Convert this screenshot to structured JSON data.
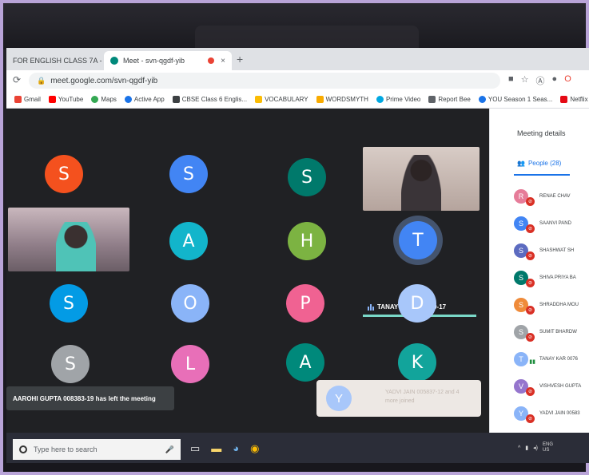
{
  "browser": {
    "tabs": [
      {
        "label": "FOR ENGLISH CLASS 7A - \\",
        "close": "×"
      },
      {
        "label": "Meet - svn-qgdf-yib",
        "close": "×"
      }
    ],
    "new_tab": "+",
    "url": "meet.google.com/svn-qgdf-yib",
    "bookmarks": [
      "Gmail",
      "YouTube",
      "Maps",
      "Active App",
      "CBSE Class 6 Englis...",
      "VOCABULARY",
      "WORDSMYTH",
      "Prime Video",
      "Report Bee",
      "YOU Season 1 Seas...",
      "Netflix"
    ]
  },
  "meet": {
    "tiles": [
      {
        "letter": "S",
        "color": "#f4511e"
      },
      {
        "letter": "S",
        "color": "#4285f4"
      },
      {
        "letter": "S",
        "color": "#00796b"
      },
      {
        "letter": "A",
        "color": "#12b5cb"
      },
      {
        "letter": "H",
        "color": "#7cb342"
      },
      {
        "letter": "T",
        "color": "#4285f4"
      },
      {
        "letter": "S",
        "color": "#039be5"
      },
      {
        "letter": "O",
        "color": "#8ab4f8"
      },
      {
        "letter": "P",
        "color": "#f06292"
      },
      {
        "letter": "D",
        "color": "#a8c7fa"
      },
      {
        "letter": "S",
        "color": "#a0a4a8"
      },
      {
        "letter": "L",
        "color": "#e86fb8"
      },
      {
        "letter": "A",
        "color": "#00897b"
      },
      {
        "letter": "K",
        "color": "#12a49b"
      }
    ],
    "active_speaker": "TANAY KAR 007689-17",
    "left_toast": "AAROHI GUPTA 008383-19 has left the meeting",
    "right_toast": {
      "avatar": "Y",
      "text": "YADVI JAIN 005837-12 and 4 more joined"
    }
  },
  "panel": {
    "title": "Meeting details",
    "people_tab": "People (28)",
    "people": [
      {
        "initial": "R",
        "name": "RENAE CHAV",
        "color": "#e67c99",
        "state": "muted"
      },
      {
        "initial": "S",
        "name": "SAANVI PAND",
        "color": "#4285f4",
        "state": "muted"
      },
      {
        "initial": "S",
        "name": "SHASHWAT SH",
        "color": "#5c6bc0",
        "state": "muted"
      },
      {
        "initial": "S",
        "name": "SHIVA PRIYA BA",
        "color": "#00796b",
        "state": "muted"
      },
      {
        "initial": "S",
        "name": "SHRADDHA MOU",
        "color": "#ef8b3a",
        "state": "muted"
      },
      {
        "initial": "S",
        "name": "SUMIT BHARDW",
        "color": "#a0a4a8",
        "state": "muted"
      },
      {
        "initial": "T",
        "name": "TANAY KAR 0076",
        "color": "#8ab4f8",
        "state": "speaking"
      },
      {
        "initial": "V",
        "name": "VISHVESH GUPTA",
        "color": "#9575cd",
        "state": "muted"
      },
      {
        "initial": "Y",
        "name": "YADVI JAIN 00583",
        "color": "#8ab4f8",
        "state": "muted"
      }
    ]
  },
  "taskbar": {
    "search_placeholder": "Type here to search",
    "lang": "ENG",
    "region": "US"
  }
}
